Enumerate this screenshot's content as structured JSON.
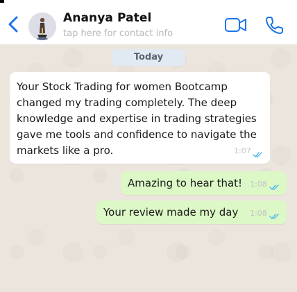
{
  "contact": {
    "name": "Ananya Patel",
    "subtitle": "tap here for contact info"
  },
  "header_icons": {
    "back": "chevron-left-icon",
    "video": "video-camera-icon",
    "call": "phone-icon"
  },
  "date_separator": "Today",
  "messages": [
    {
      "direction": "incoming",
      "text": "Your Stock Trading for women Bootcamp changed my trading completely. The deep knowledge and expertise in trading strategies gave me tools and confidence to navigate the markets like a pro.",
      "time": "1:07",
      "status": "read"
    },
    {
      "direction": "outgoing",
      "text": "Amazing to hear that!",
      "time": "1:08",
      "status": "read"
    },
    {
      "direction": "outgoing",
      "text": "Your review made my day",
      "time": "1:08",
      "status": "read"
    }
  ],
  "colors": {
    "accent": "#1a73e8",
    "outgoing_bubble": "#dcf8c6",
    "incoming_bubble": "#ffffff",
    "read_tick": "#4fb6ec",
    "chat_background": "#ece5dd"
  }
}
